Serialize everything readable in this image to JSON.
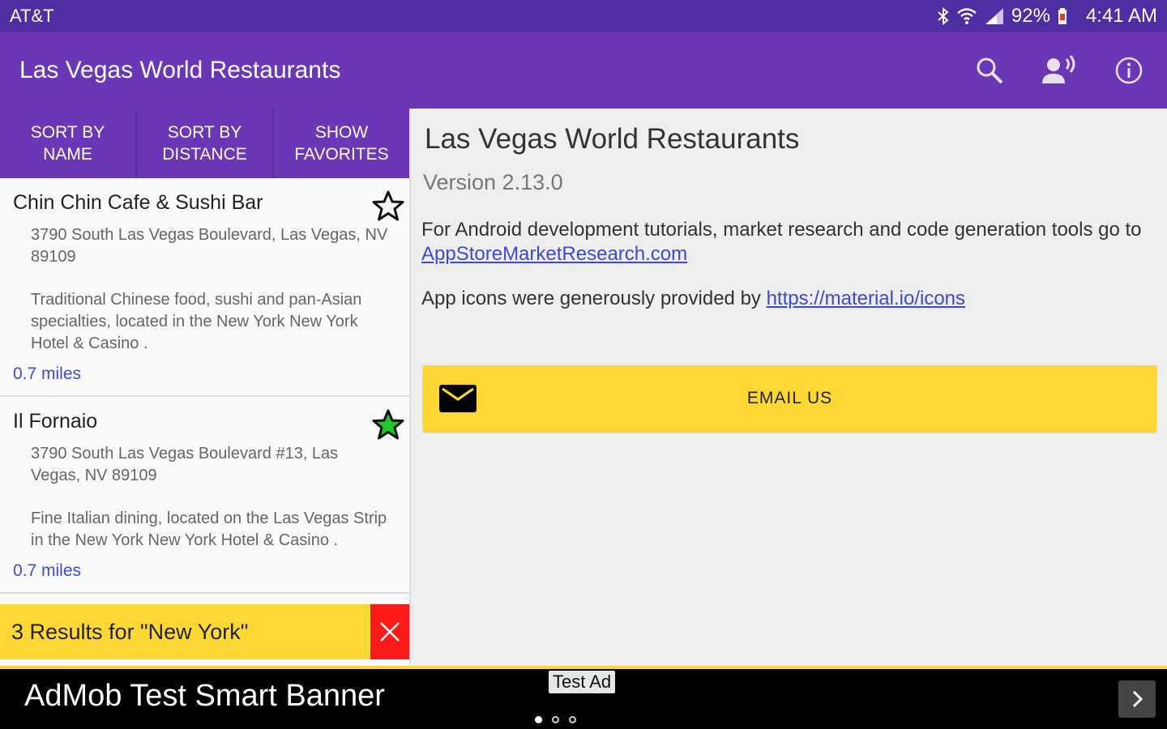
{
  "status_bar": {
    "carrier": "AT&T",
    "battery": "92%",
    "time": "4:41 AM"
  },
  "app_bar": {
    "title": "Las Vegas World Restaurants",
    "actions": [
      "search-icon",
      "voice-search-icon",
      "info-icon"
    ]
  },
  "tabs": [
    {
      "line1": "SORT BY",
      "line2": "NAME"
    },
    {
      "line1": "SORT BY",
      "line2": "DISTANCE"
    },
    {
      "line1": "SHOW",
      "line2": "FAVORITES"
    }
  ],
  "restaurants": [
    {
      "name": "Chin Chin Cafe & Sushi Bar",
      "address": "3790 South Las Vegas Boulevard, Las Vegas, NV 89109",
      "description": "Traditional Chinese food, sushi and pan-Asian specialties, located in the New York New York Hotel & Casino .",
      "distance": "0.7 miles",
      "favorite": false
    },
    {
      "name": "Il Fornaio",
      "address": "3790 South Las Vegas Boulevard #13, Las Vegas, NV 89109",
      "description": "Fine Italian dining, located on the Las Vegas Strip in the New York New York Hotel & Casino .",
      "distance": "0.7 miles",
      "favorite": true
    }
  ],
  "results_bar": {
    "text": "3 Results for \"New York\""
  },
  "about": {
    "title": "Las Vegas World Restaurants",
    "version": "Version 2.13.0",
    "tutorials_text": "For Android development tutorials, market research and code generation tools go to ",
    "tutorials_link": "AppStoreMarketResearch.com",
    "icons_text": "App icons were generously provided by ",
    "icons_link": "https://material.io/icons",
    "email_label": "EMAIL US"
  },
  "ad": {
    "text": "AdMob Test Smart Banner",
    "tag": "Test Ad"
  },
  "colors": {
    "status_bar": "#4f2da3",
    "app_bar": "#6a38b7",
    "accent_yellow": "#fdd835",
    "link": "#3c4ad6",
    "favorite_green": "#22c52a",
    "close_red": "#ff1a1a"
  }
}
